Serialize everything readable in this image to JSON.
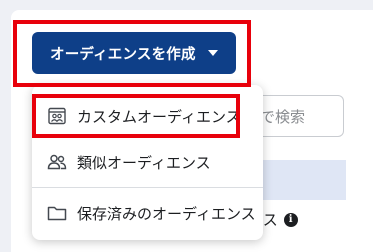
{
  "create_button": {
    "label": "オーディエンスを作成"
  },
  "search": {
    "placeholder_fragment": "で検索"
  },
  "background_row": {
    "label_fragment": "ンス"
  },
  "menu": {
    "items": [
      {
        "label": "カスタムオーディエンス",
        "icon": "custom-audience-icon"
      },
      {
        "label": "類似オーディエンス",
        "icon": "people-icon"
      },
      {
        "label": "保存済みのオーディエンス",
        "icon": "folder-icon"
      }
    ]
  },
  "colors": {
    "button_bg": "#0e3f88",
    "highlight": "#e8000b",
    "strip": "#dfe6f5"
  }
}
